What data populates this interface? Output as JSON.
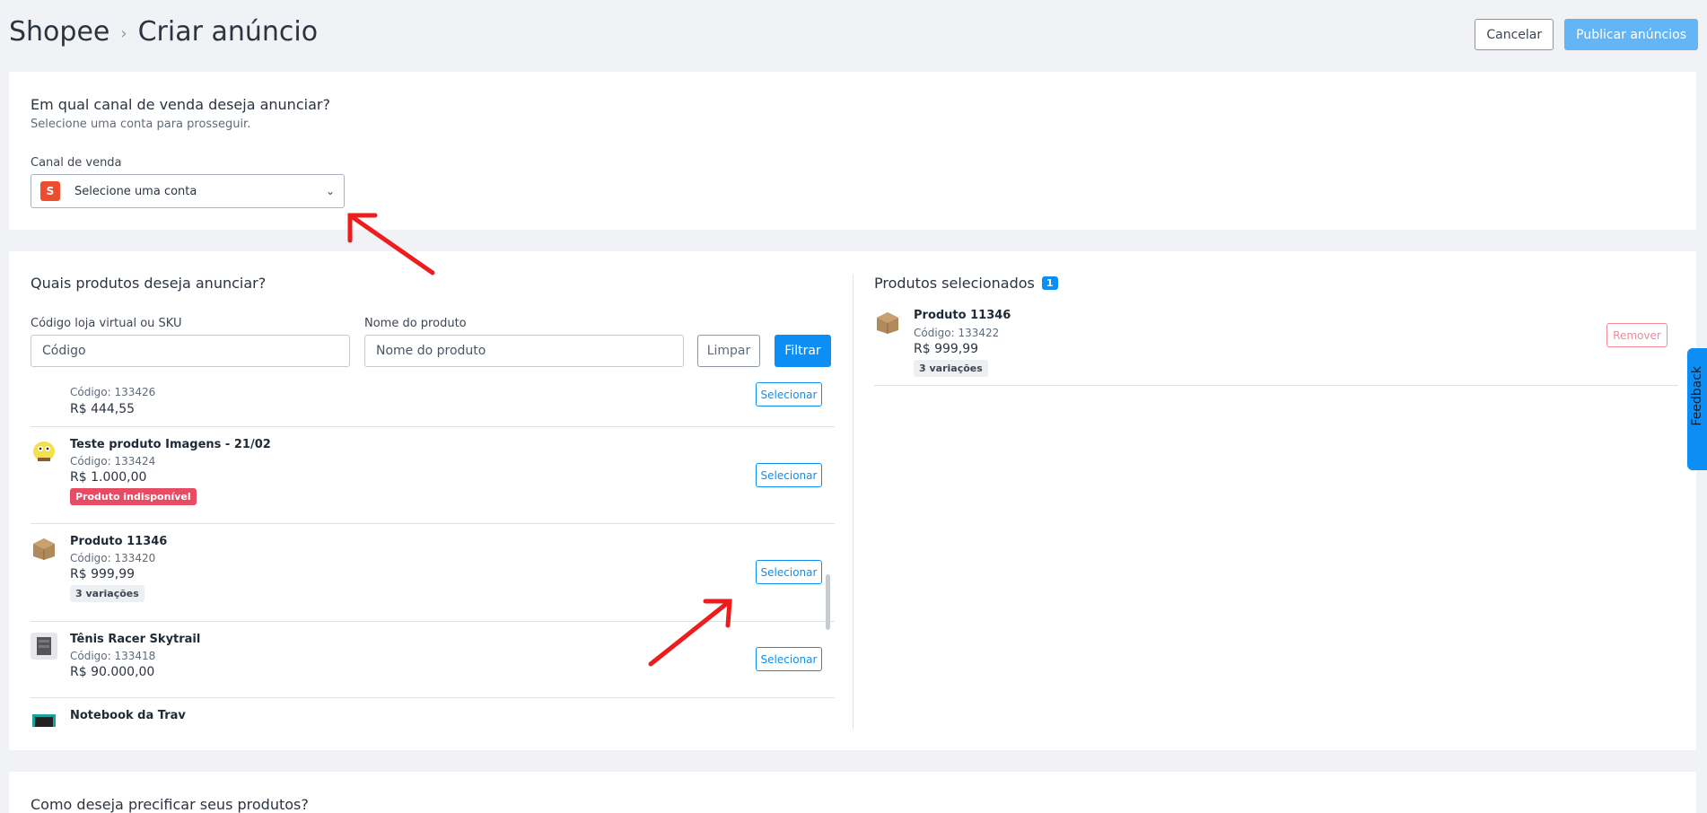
{
  "header": {
    "breadcrumb_root": "Shopee",
    "breadcrumb_sep": "›",
    "title": "Criar anúncio",
    "cancel_label": "Cancelar",
    "publish_label": "Publicar anúncios"
  },
  "channel": {
    "question": "Em qual canal de venda deseja anunciar?",
    "subtitle": "Selecione uma conta para prosseguir.",
    "field_label": "Canal de venda",
    "selected": "Selecione uma conta"
  },
  "products": {
    "question": "Quais produtos deseja anunciar?",
    "code_label": "Código loja virtual ou SKU",
    "code_placeholder": "Código",
    "name_label": "Nome do produto",
    "name_placeholder": "Nome do produto",
    "clear_label": "Limpar",
    "filter_label": "Filtrar",
    "select_label": "Selecionar",
    "items": [
      {
        "name": "",
        "code": "Código: 133426",
        "price": "R$ 444,55"
      },
      {
        "name": "Teste produto Imagens - 21/02",
        "code": "Código: 133424",
        "price": "R$ 1.000,00",
        "badge": "Produto indisponível"
      },
      {
        "name": "Produto 11346",
        "code": "Código: 133420",
        "price": "R$ 999,99",
        "badge": "3 variações"
      },
      {
        "name": "Tênis Racer Skytrail",
        "code": "Código: 133418",
        "price": "R$ 90.000,00"
      },
      {
        "name": "Notebook da Trav"
      }
    ]
  },
  "selected": {
    "title": "Produtos selecionados",
    "count": "1",
    "item": {
      "name": "Produto 11346",
      "code": "Código: 133422",
      "price": "R$ 999,99",
      "badge": "3 variações"
    },
    "remove_label": "Remover"
  },
  "pricing": {
    "question": "Como deseja precificar seus produtos?"
  },
  "feedback_label": "Feedback",
  "colors": {
    "primary": "#0d8ef5",
    "shopee": "#ee4d2d",
    "danger": "#e74c65",
    "annotation": "#ee1c1c"
  }
}
